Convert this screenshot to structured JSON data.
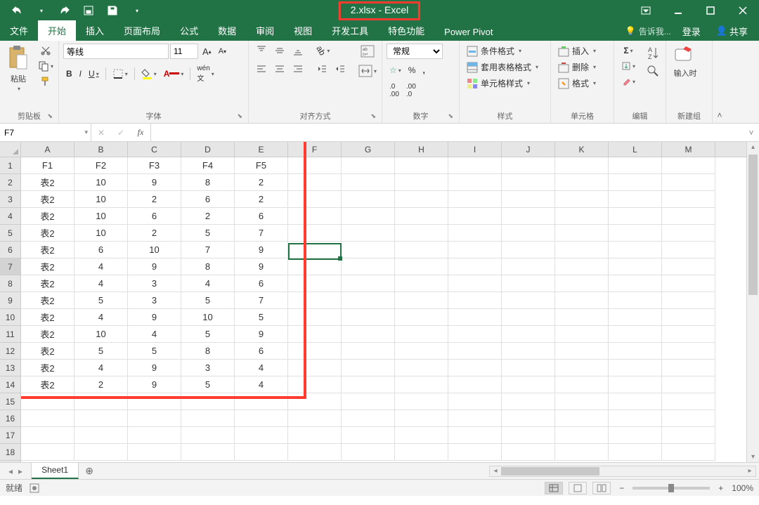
{
  "title": "2.xlsx - Excel",
  "qat": {
    "undo": "↶",
    "redo": "↷"
  },
  "tabs": {
    "items": [
      "文件",
      "开始",
      "插入",
      "页面布局",
      "公式",
      "数据",
      "审阅",
      "视图",
      "开发工具",
      "特色功能",
      "Power Pivot"
    ],
    "active": 1,
    "tellme": "告诉我...",
    "login": "登录",
    "share": "共享"
  },
  "ribbon": {
    "clipboard": {
      "label": "剪贴板",
      "paste": "粘贴"
    },
    "font": {
      "label": "字体",
      "name": "等线",
      "size": "11",
      "bold": "B",
      "italic": "I",
      "underline": "U"
    },
    "align": {
      "label": "对齐方式",
      "wrap": "",
      "merge": ""
    },
    "number": {
      "label": "数字",
      "format": "常规"
    },
    "styles": {
      "label": "样式",
      "cond": "条件格式",
      "table": "套用表格格式",
      "cell": "单元格样式"
    },
    "cells": {
      "label": "单元格",
      "insert": "插入",
      "delete": "删除",
      "format": "格式"
    },
    "editing": {
      "label": "编辑"
    },
    "newgroup": {
      "label": "新建组",
      "inktext": "输入时"
    }
  },
  "fbar": {
    "namebox": "F7",
    "fx": "fx",
    "formula": ""
  },
  "grid": {
    "cols": [
      "A",
      "B",
      "C",
      "D",
      "E",
      "F",
      "G",
      "H",
      "I",
      "J",
      "K",
      "L",
      "M"
    ],
    "rows": [
      [
        "F1",
        "F2",
        "F3",
        "F4",
        "F5",
        "",
        "",
        "",
        "",
        "",
        "",
        "",
        ""
      ],
      [
        "表2",
        "10",
        "9",
        "8",
        "2",
        "",
        "",
        "",
        "",
        "",
        "",
        "",
        ""
      ],
      [
        "表2",
        "10",
        "2",
        "6",
        "2",
        "",
        "",
        "",
        "",
        "",
        "",
        "",
        ""
      ],
      [
        "表2",
        "10",
        "6",
        "2",
        "6",
        "",
        "",
        "",
        "",
        "",
        "",
        "",
        ""
      ],
      [
        "表2",
        "10",
        "2",
        "5",
        "7",
        "",
        "",
        "",
        "",
        "",
        "",
        "",
        ""
      ],
      [
        "表2",
        "6",
        "10",
        "7",
        "9",
        "",
        "",
        "",
        "",
        "",
        "",
        "",
        ""
      ],
      [
        "表2",
        "4",
        "9",
        "8",
        "9",
        "",
        "",
        "",
        "",
        "",
        "",
        "",
        ""
      ],
      [
        "表2",
        "4",
        "3",
        "4",
        "6",
        "",
        "",
        "",
        "",
        "",
        "",
        "",
        ""
      ],
      [
        "表2",
        "5",
        "3",
        "5",
        "7",
        "",
        "",
        "",
        "",
        "",
        "",
        "",
        ""
      ],
      [
        "表2",
        "4",
        "9",
        "10",
        "5",
        "",
        "",
        "",
        "",
        "",
        "",
        "",
        ""
      ],
      [
        "表2",
        "10",
        "4",
        "5",
        "9",
        "",
        "",
        "",
        "",
        "",
        "",
        "",
        ""
      ],
      [
        "表2",
        "5",
        "5",
        "8",
        "6",
        "",
        "",
        "",
        "",
        "",
        "",
        "",
        ""
      ],
      [
        "表2",
        "4",
        "9",
        "3",
        "4",
        "",
        "",
        "",
        "",
        "",
        "",
        "",
        ""
      ],
      [
        "表2",
        "2",
        "9",
        "5",
        "4",
        "",
        "",
        "",
        "",
        "",
        "",
        "",
        ""
      ],
      [
        "",
        "",
        "",
        "",
        "",
        "",
        "",
        "",
        "",
        "",
        "",
        "",
        ""
      ],
      [
        "",
        "",
        "",
        "",
        "",
        "",
        "",
        "",
        "",
        "",
        "",
        "",
        ""
      ],
      [
        "",
        "",
        "",
        "",
        "",
        "",
        "",
        "",
        "",
        "",
        "",
        "",
        ""
      ],
      [
        "",
        "",
        "",
        "",
        "",
        "",
        "",
        "",
        "",
        "",
        "",
        "",
        ""
      ]
    ],
    "active": {
      "row": 7,
      "col": "F"
    }
  },
  "sheets": {
    "active": "Sheet1"
  },
  "status": {
    "ready": "就绪",
    "zoom": "100%"
  }
}
